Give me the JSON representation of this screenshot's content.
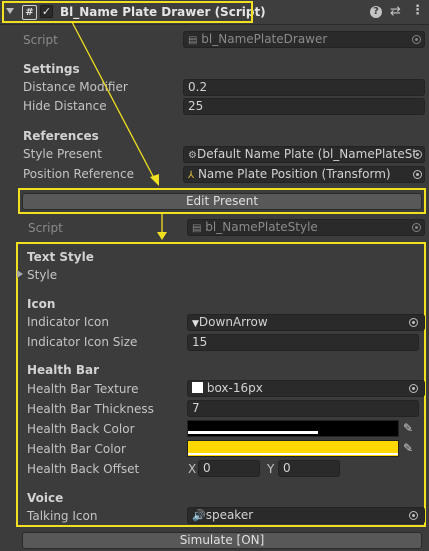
{
  "header": {
    "title": "Bl_Name Plate Drawer (Script)",
    "icons": [
      "help-icon",
      "preset-icon",
      "kebab-menu-icon"
    ]
  },
  "drawer": {
    "script_label": "Script",
    "script_value": "bl_NamePlateDrawer",
    "settings_header": "Settings",
    "distance_modifier_label": "Distance Modifier",
    "distance_modifier_value": "0.2",
    "hide_distance_label": "Hide Distance",
    "hide_distance_value": "25",
    "references_header": "References",
    "style_present_label": "Style Present",
    "style_present_value": "Default Name Plate (bl_NamePlateSt",
    "position_reference_label": "Position Reference",
    "position_reference_value": "Name Plate Position (Transform)",
    "edit_button": "Edit Present"
  },
  "style": {
    "script_label": "Script",
    "script_value": "bl_NamePlateStyle",
    "text_style_header": "Text Style",
    "style_foldout": "Style",
    "icon_header": "Icon",
    "indicator_icon_label": "Indicator Icon",
    "indicator_icon_value": "DownArrow",
    "indicator_icon_size_label": "Indicator Icon Size",
    "indicator_icon_size_value": "15",
    "health_bar_header": "Health Bar",
    "health_bar_texture_label": "Health Bar Texture",
    "health_bar_texture_value": "box-16px",
    "health_bar_thickness_label": "Health Bar Thickness",
    "health_bar_thickness_value": "7",
    "health_back_color_label": "Health Back Color",
    "health_back_color": "#000000",
    "health_bar_color_label": "Health Bar Color",
    "health_bar_color": "#ffd800",
    "health_back_offset_label": "Health Back Offset",
    "offset_x_label": "X",
    "offset_x_value": "0",
    "offset_y_label": "Y",
    "offset_y_value": "0",
    "voice_header": "Voice",
    "talking_icon_label": "Talking Icon",
    "talking_icon_value": "speaker"
  },
  "simulate_button": "Simulate [ON]",
  "colors": {
    "highlight": "#f0e021",
    "background": "#3c3c3c",
    "field": "#2a2a2a"
  }
}
